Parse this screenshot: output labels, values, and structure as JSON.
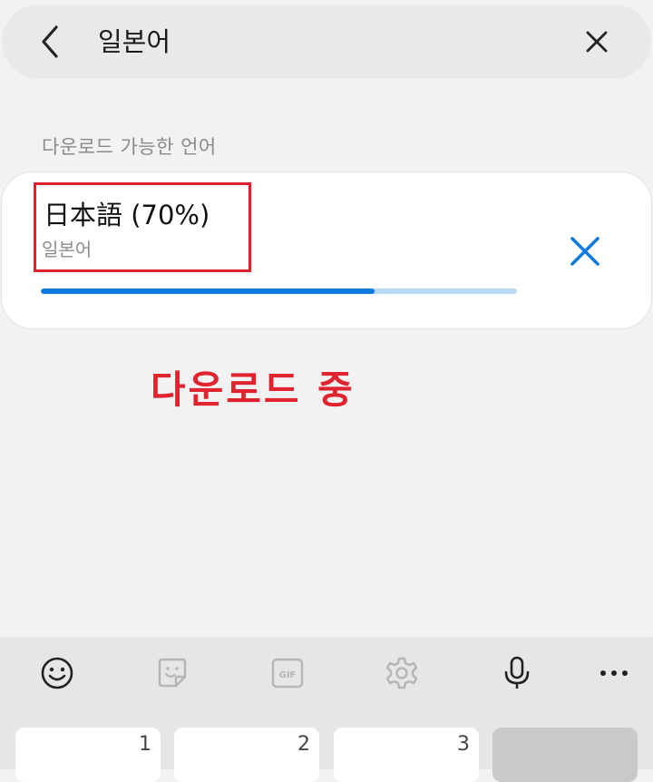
{
  "search": {
    "query": "일본어"
  },
  "section": {
    "header": "다운로드 가능한 언어"
  },
  "language_item": {
    "name": "日本語 (70%)",
    "subtitle": "일본어",
    "progress": 0.7
  },
  "annotation": {
    "text": "다운로드 중"
  },
  "keyboard": {
    "toolbar_icons": [
      "emoji-icon",
      "sticker-icon",
      "gif-icon",
      "settings-icon",
      "mic-icon",
      "more-icon"
    ],
    "toolbar_gif_label": "GIF",
    "keys": [
      {
        "number": "1"
      },
      {
        "number": "2"
      },
      {
        "number": "3"
      }
    ]
  },
  "colors": {
    "accent": "#0f7be0",
    "progress_track": "#b7d9f5",
    "highlight": "#d9232d",
    "annotation": "#e0232e"
  }
}
